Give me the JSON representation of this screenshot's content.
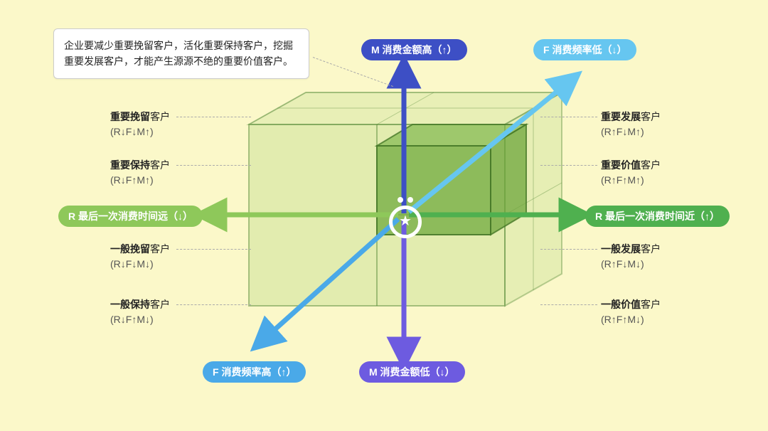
{
  "callout": "企业要减少重要挽留客户，活化重要保持客户，挖掘重要发展客户，才能产生源源不绝的重要价值客户。",
  "axes": {
    "m_high": "M 消费金额高（↑）",
    "m_low": "M 消费金额低（↓）",
    "f_low": "F 消费频率低（↓）",
    "f_high": "F 消费频率高（↑）",
    "r_far": "R 最后一次消费时间远（↓）",
    "r_near": "R 最后一次消费时间近（↑）"
  },
  "segment_suffix": "客户",
  "segments": {
    "left": [
      {
        "title": "重要挽留",
        "formula": "(R↓F↓M↑)"
      },
      {
        "title": "重要保持",
        "formula": "(R↓F↑M↑)"
      },
      {
        "title": "一般挽留",
        "formula": "(R↓F↓M↓)"
      },
      {
        "title": "一般保持",
        "formula": "(R↓F↑M↓)"
      }
    ],
    "right": [
      {
        "title": "重要发展",
        "formula": "(R↑F↓M↑)"
      },
      {
        "title": "重要价值",
        "formula": "(R↑F↑M↑)"
      },
      {
        "title": "一般发展",
        "formula": "(R↑F↓M↓)"
      },
      {
        "title": "一般价值",
        "formula": "(R↑F↑M↓)"
      }
    ]
  }
}
